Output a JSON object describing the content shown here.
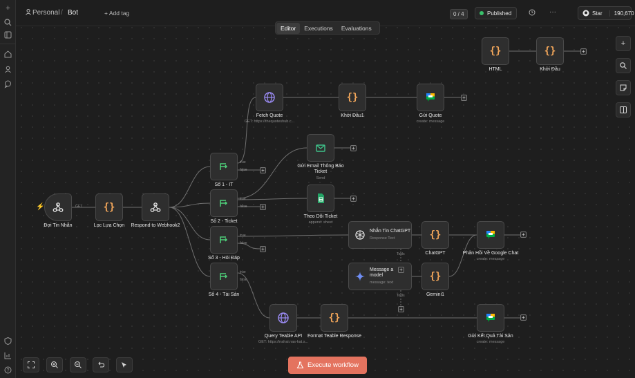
{
  "topbar": {
    "breadcrumb_project": "Personal",
    "breadcrumb_separator": "/",
    "workflow_name": "Bot",
    "add_tag": "+ Add tag",
    "counter": "0 / 4",
    "status": "Published",
    "star_label": "Star",
    "star_count": "190,670"
  },
  "tabs": [
    "Editor",
    "Executions",
    "Evaluations"
  ],
  "nodes": {
    "html": {
      "label": "HTML"
    },
    "khoi_dau": {
      "label": "Khởi Đầu"
    },
    "fetch_quote": {
      "label": "Fetch Quote",
      "sub": "GET: https://thequoteshub.c..."
    },
    "khoi_dau1": {
      "label": "Khởi Đầu1"
    },
    "gui_quote": {
      "label": "Gửi Quote",
      "sub": "create: message"
    },
    "gui_email": {
      "label": "Gửi Email Thông Báo Ticket",
      "sub": "Send"
    },
    "so1": {
      "label": "Số 1 - IT"
    },
    "so2": {
      "label": "Số 2 - Ticket"
    },
    "so3": {
      "label": "Số 3 - Hỏi Đáp"
    },
    "so4": {
      "label": "Số 4 - Tài Sản"
    },
    "theo_doi": {
      "label": "Theo Dõi Ticket",
      "sub": "append: sheet"
    },
    "doi_tin_nhan": {
      "label": "Đợi Tin Nhắn"
    },
    "loc_lua_chon": {
      "label": "Lọc Lựa Chọn"
    },
    "respond": {
      "label": "Respond to Webhook2"
    },
    "nhan_tin": {
      "label": "Nhắn Tin ChatGPT",
      "sub": "Response Text"
    },
    "chatgpt": {
      "label": "ChatGPT"
    },
    "phan_hoi": {
      "label": "Phản Hồi Về Google Chat",
      "sub": "create: message"
    },
    "message_model": {
      "label": "Message a model",
      "sub": "message: text"
    },
    "gemini1": {
      "label": "Gemini1"
    },
    "query_teable": {
      "label": "Query Teable API",
      "sub": "GET: https://nahai.nas-kat.s..."
    },
    "format_teable": {
      "label": "Format Teable Response"
    },
    "gui_ket_qua": {
      "label": "Gửi Kết Quả Tài Sản",
      "sub": "create: message"
    }
  },
  "edge_labels": {
    "get": "GET",
    "true": "true",
    "false": "false",
    "tools": "Tools"
  },
  "execute_button": "Execute workflow",
  "icons": {
    "left": [
      "plus-icon",
      "search-icon",
      "sidebar-icon",
      "home-icon",
      "user-icon",
      "chat-icon",
      "shield-icon",
      "chart-icon",
      "help-icon"
    ],
    "right": [
      "plus-icon",
      "search-icon",
      "sticky-note-icon",
      "panel-icon"
    ],
    "bottom": [
      "fit-view-icon",
      "zoom-in-icon",
      "zoom-out-icon",
      "undo-icon",
      "tidy-icon"
    ]
  },
  "colors": {
    "accent": "#e4735f",
    "published": "#39c16b",
    "braces": "#f2a65a"
  }
}
